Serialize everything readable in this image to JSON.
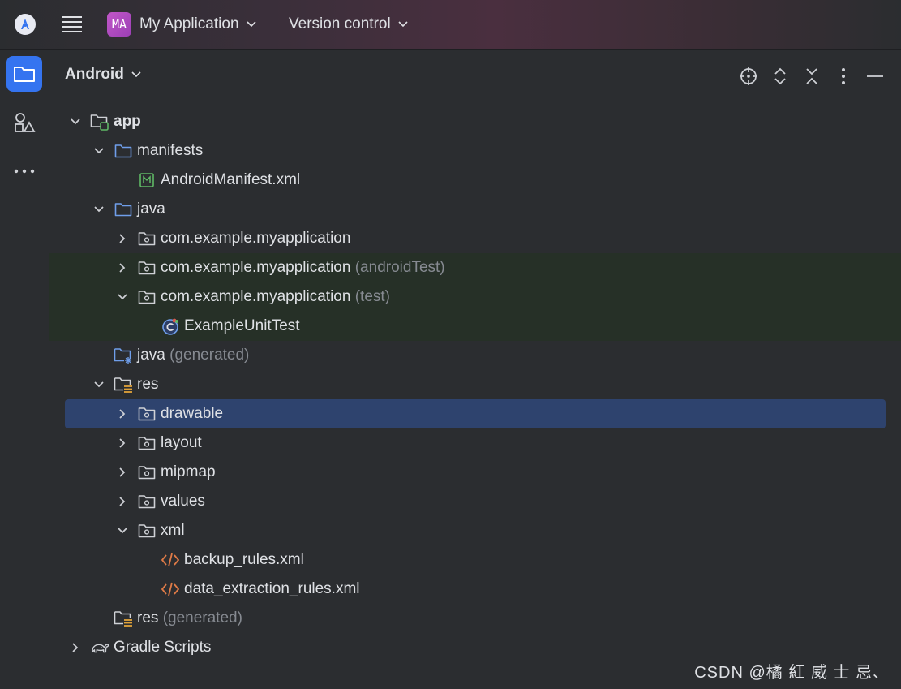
{
  "titlebar": {
    "project_badge": "MA",
    "project_name": "My Application",
    "version_control": "Version control"
  },
  "panel": {
    "title": "Android"
  },
  "tree": [
    {
      "label": "app",
      "suffix": "",
      "depth": 0,
      "expand": "open",
      "icon": "module-folder-icon",
      "bold": true
    },
    {
      "label": "manifests",
      "suffix": "",
      "depth": 1,
      "expand": "open",
      "icon": "folder-icon"
    },
    {
      "label": "AndroidManifest.xml",
      "suffix": "",
      "depth": 2,
      "expand": "none",
      "icon": "manifest-file-icon"
    },
    {
      "label": "java",
      "suffix": "",
      "depth": 1,
      "expand": "open",
      "icon": "folder-icon"
    },
    {
      "label": "com.example.myapplication",
      "suffix": "",
      "depth": 2,
      "expand": "closed",
      "icon": "package-icon"
    },
    {
      "label": "com.example.myapplication",
      "suffix": "(androidTest)",
      "depth": 2,
      "expand": "closed",
      "icon": "package-icon",
      "highlight": true
    },
    {
      "label": "com.example.myapplication",
      "suffix": "(test)",
      "depth": 2,
      "expand": "open",
      "icon": "package-icon",
      "highlight": true
    },
    {
      "label": "ExampleUnitTest",
      "suffix": "",
      "depth": 3,
      "expand": "none",
      "icon": "test-class-icon",
      "highlight": true
    },
    {
      "label": "java",
      "suffix": "(generated)",
      "depth": 1,
      "expand": "none",
      "icon": "generated-folder-icon"
    },
    {
      "label": "res",
      "suffix": "",
      "depth": 1,
      "expand": "open",
      "icon": "resource-folder-icon"
    },
    {
      "label": "drawable",
      "suffix": "",
      "depth": 2,
      "expand": "closed",
      "icon": "package-icon",
      "selected": true
    },
    {
      "label": "layout",
      "suffix": "",
      "depth": 2,
      "expand": "closed",
      "icon": "package-icon"
    },
    {
      "label": "mipmap",
      "suffix": "",
      "depth": 2,
      "expand": "closed",
      "icon": "package-icon"
    },
    {
      "label": "values",
      "suffix": "",
      "depth": 2,
      "expand": "closed",
      "icon": "package-icon"
    },
    {
      "label": "xml",
      "suffix": "",
      "depth": 2,
      "expand": "open",
      "icon": "package-icon"
    },
    {
      "label": "backup_rules.xml",
      "suffix": "",
      "depth": 3,
      "expand": "none",
      "icon": "xml-file-icon"
    },
    {
      "label": "data_extraction_rules.xml",
      "suffix": "",
      "depth": 3,
      "expand": "none",
      "icon": "xml-file-icon"
    },
    {
      "label": "res",
      "suffix": "(generated)",
      "depth": 1,
      "expand": "none",
      "icon": "resource-folder-icon"
    },
    {
      "label": "Gradle Scripts",
      "suffix": "",
      "depth": 0,
      "expand": "closed",
      "icon": "gradle-icon"
    }
  ],
  "watermark": "CSDN @橘 紅 威 士 忌、",
  "colors": {
    "accent": "#3574f0",
    "selection": "#2e436e",
    "test_highlight": "#263027",
    "background": "#2b2d30"
  }
}
